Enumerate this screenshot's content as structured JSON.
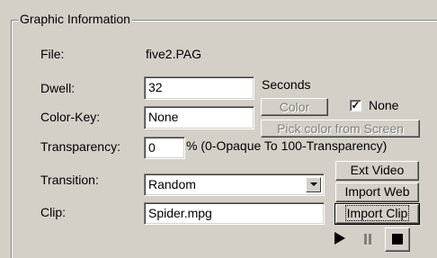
{
  "group": {
    "title": "Graphic Information"
  },
  "file": {
    "label": "File:",
    "value": "five2.PAG"
  },
  "dwell": {
    "label": "Dwell:",
    "value": "32",
    "unit": "Seconds"
  },
  "color_key": {
    "label": "Color-Key:",
    "value": "None",
    "color_button": "Color",
    "none_checkbox_label": "None",
    "none_checked": true,
    "pick_button": "Pick color from Screen"
  },
  "transparency": {
    "label": "Transparency:",
    "value": "0",
    "hint": "% (0-Opaque To 100-Transparency)"
  },
  "transition": {
    "label": "Transition:",
    "value": "Random"
  },
  "clip": {
    "label": "Clip:",
    "value": "Spider.mpg"
  },
  "buttons": {
    "ext_video": "Ext Video",
    "import_web": "Import Web",
    "import_clip": "Import Clip"
  },
  "media_controls": [
    "play-icon",
    "pause-icon",
    "stop-icon"
  ]
}
